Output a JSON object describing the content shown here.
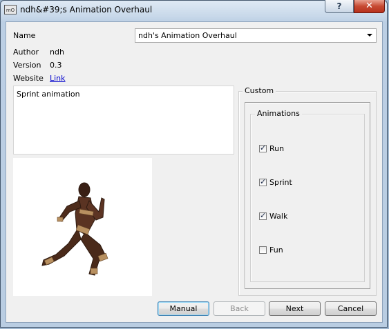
{
  "window": {
    "title": "ndh&#39;s Animation Overhaul",
    "app_icon_text": "mO",
    "help_button": "?",
    "close_button": "✕"
  },
  "form": {
    "name_label": "Name",
    "name_value": "ndh's Animation Overhaul",
    "author_label": "Author",
    "author_value": "ndh",
    "version_label": "Version",
    "version_value": "0.3",
    "website_label": "Website",
    "website_link": "Link",
    "description": "Sprint animation"
  },
  "custom": {
    "group_title": "Custom",
    "animations": {
      "group_title": "Animations",
      "items": [
        {
          "label": "Run",
          "checked": true
        },
        {
          "label": "Sprint",
          "checked": true
        },
        {
          "label": "Walk",
          "checked": true
        },
        {
          "label": "Fun",
          "checked": false
        }
      ]
    }
  },
  "buttons": {
    "manual": "Manual",
    "back": "Back",
    "next": "Next",
    "cancel": "Cancel"
  },
  "colors": {
    "link": "#0000cc",
    "close_button": "#c74a33",
    "client_bg": "#f0f0f0"
  }
}
